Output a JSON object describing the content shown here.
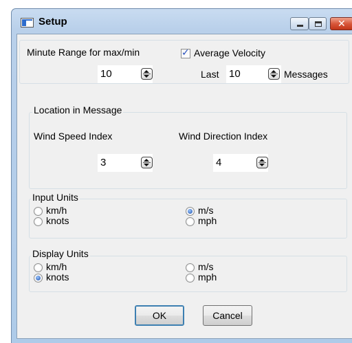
{
  "window": {
    "title": "Setup",
    "icon": "app-window-icon"
  },
  "controls": {
    "minimize": "minimize-icon",
    "maximize": "maximize-icon",
    "close": "close-icon",
    "close_glyph": "✕"
  },
  "top": {
    "minute_range_label": "Minute Range for max/min",
    "minute_range_value": "10",
    "average_velocity_label": "Average Velocity",
    "average_velocity_checked": true,
    "last_label": "Last",
    "last_value": "10",
    "messages_label": "Messages"
  },
  "location": {
    "legend": "Location in Message",
    "wind_speed_label": "Wind Speed Index",
    "wind_speed_value": "3",
    "wind_direction_label": "Wind Direction Index",
    "wind_direction_value": "4"
  },
  "input_units": {
    "legend": "Input Units",
    "options": [
      "km/h",
      "knots",
      "m/s",
      "mph"
    ],
    "selected": "m/s"
  },
  "display_units": {
    "legend": "Display Units",
    "options": [
      "km/h",
      "knots",
      "m/s",
      "mph"
    ],
    "selected": "knots"
  },
  "buttons": {
    "ok": "OK",
    "cancel": "Cancel"
  },
  "colors": {
    "title_bar": "#b9d0ea",
    "close_button": "#c23518",
    "client": "#f0f0f0",
    "accent": "#2a52be"
  }
}
